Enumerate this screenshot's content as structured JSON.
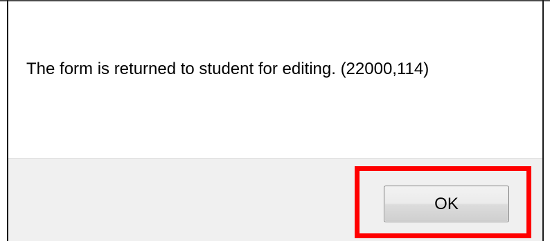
{
  "dialog": {
    "message": "The form is returned to student for editing. (22000,114)",
    "ok_label": "OK"
  },
  "annotation": {
    "highlight_color": "#ff0000",
    "highlight_target": "ok-button"
  }
}
